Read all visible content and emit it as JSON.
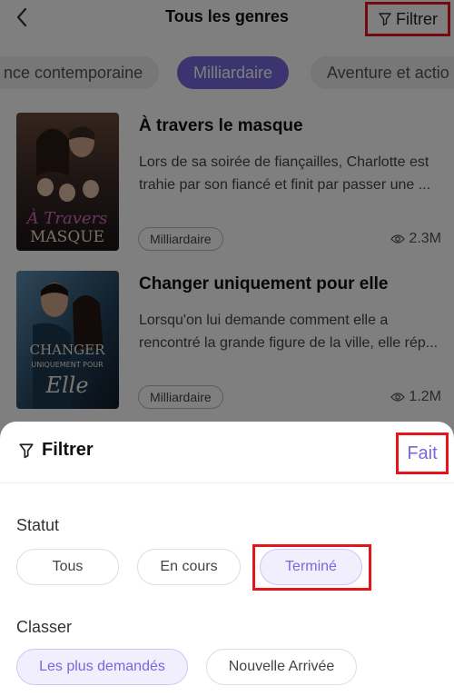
{
  "header": {
    "title": "Tous les genres",
    "filter_label": "Filtrer"
  },
  "genres": [
    "nce contemporaine",
    "Milliardaire",
    "Aventure et actio"
  ],
  "active_genre_index": 1,
  "books": [
    {
      "title": "À travers le masque",
      "description": "Lors de sa soirée de fiançailles, Charlotte est trahie par son fiancé et finit par passer une ...",
      "tag": "Milliardaire",
      "views": "2.3M",
      "cover_text": [
        "À Travers",
        "MASQUE"
      ]
    },
    {
      "title": "Changer uniquement pour elle",
      "description": "Lorsqu'on lui demande comment elle a rencontré la grande figure de la ville, elle rép...",
      "tag": "Milliardaire",
      "views": "1.2M",
      "cover_text": [
        "CHANGER",
        "UNIQUEMENT POUR",
        "Elle"
      ]
    }
  ],
  "sheet": {
    "title": "Filtrer",
    "done_label": "Fait",
    "status_label": "Statut",
    "status_options": [
      "Tous",
      "En cours",
      "Terminé"
    ],
    "status_selected": "Terminé",
    "sort_label": "Classer",
    "sort_options": [
      "Les plus demandés",
      "Nouvelle Arrivée"
    ],
    "sort_selected": "Les plus demandés"
  },
  "colors": {
    "accent": "#7768dd",
    "highlight": "#e8141b"
  }
}
